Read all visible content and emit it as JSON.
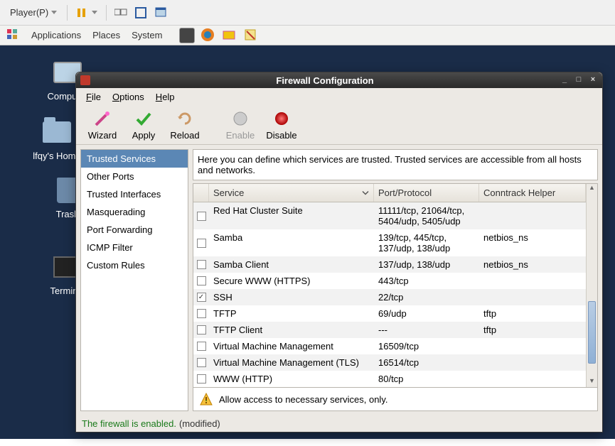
{
  "vmbar": {
    "player_label": "Player(P)"
  },
  "panel": {
    "apps": "Applications",
    "places": "Places",
    "system": "System"
  },
  "desktop_icons": {
    "computer": "Computer",
    "home": "lfqy's Home",
    "trash": "Trash",
    "terminal": "Terminal"
  },
  "window_title": "Firewall Configuration",
  "menubar": {
    "file": "File",
    "options": "Options",
    "help": "Help"
  },
  "toolbar": {
    "wizard": "Wizard",
    "apply": "Apply",
    "reload": "Reload",
    "enable": "Enable",
    "disable": "Disable"
  },
  "sidebar": {
    "items": [
      {
        "label": "Trusted Services",
        "selected": true
      },
      {
        "label": "Other Ports"
      },
      {
        "label": "Trusted Interfaces"
      },
      {
        "label": "Masquerading"
      },
      {
        "label": "Port Forwarding"
      },
      {
        "label": "ICMP Filter"
      },
      {
        "label": "Custom Rules"
      }
    ]
  },
  "description": "Here you can define which services are trusted. Trusted services are accessible from all hosts and networks.",
  "columns": {
    "service": "Service",
    "port": "Port/Protocol",
    "ct": "Conntrack Helper"
  },
  "rows": [
    {
      "checked": false,
      "service": "Red Hat Cluster Suite",
      "port": "11111/tcp, 21064/tcp, 5404/udp, 5405/udp",
      "ct": ""
    },
    {
      "checked": false,
      "service": "Samba",
      "port": "139/tcp, 445/tcp, 137/udp, 138/udp",
      "ct": "netbios_ns"
    },
    {
      "checked": false,
      "service": "Samba Client",
      "port": "137/udp, 138/udp",
      "ct": "netbios_ns"
    },
    {
      "checked": false,
      "service": "Secure WWW (HTTPS)",
      "port": "443/tcp",
      "ct": ""
    },
    {
      "checked": true,
      "service": "SSH",
      "port": "22/tcp",
      "ct": ""
    },
    {
      "checked": false,
      "service": "TFTP",
      "port": "69/udp",
      "ct": "tftp"
    },
    {
      "checked": false,
      "service": "TFTP Client",
      "port": "---",
      "ct": "tftp"
    },
    {
      "checked": false,
      "service": "Virtual Machine Management",
      "port": "16509/tcp",
      "ct": ""
    },
    {
      "checked": false,
      "service": "Virtual Machine Management (TLS)",
      "port": "16514/tcp",
      "ct": ""
    },
    {
      "checked": false,
      "service": "WWW (HTTP)",
      "port": "80/tcp",
      "ct": ""
    }
  ],
  "info_text": "Allow access to necessary services, only.",
  "status": {
    "enabled": "The firewall is enabled.",
    "modified": "(modified)"
  }
}
